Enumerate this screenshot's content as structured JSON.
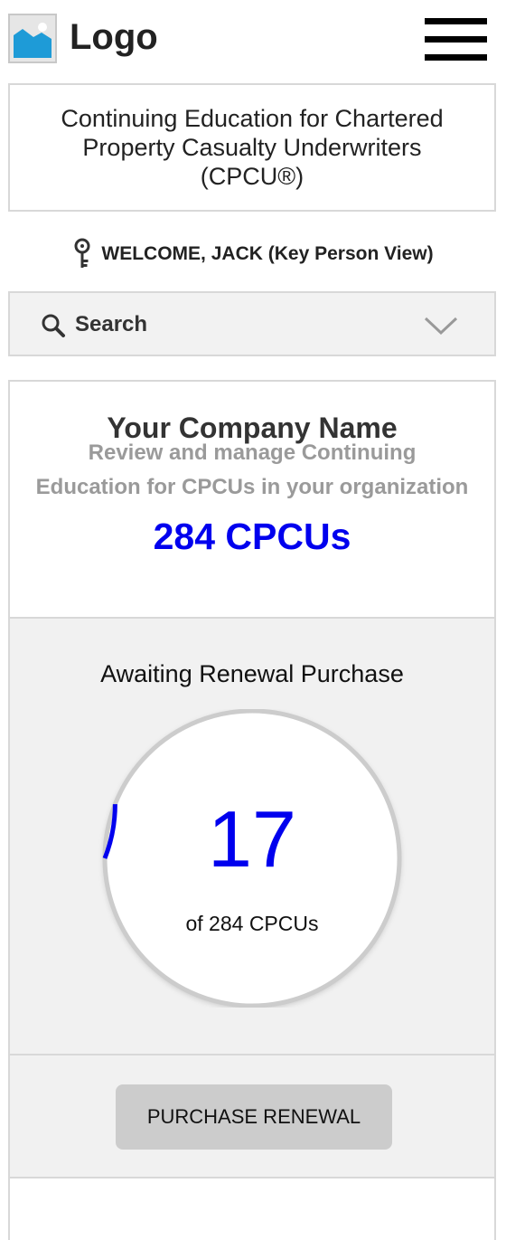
{
  "header": {
    "logo_text": "Logo",
    "logo_icon": "image-placeholder-icon",
    "menu_icon": "hamburger-menu-icon"
  },
  "program_title": "Continuing Education for Chartered Property Casualty Underwriters (CPCU®)",
  "welcome": {
    "icon": "key-icon",
    "text": "WELCOME, JACK (Key Person View)"
  },
  "search": {
    "label": "Search",
    "icon": "search-icon",
    "toggle_icon": "chevron-down-icon"
  },
  "company": {
    "name": "Your Company Name",
    "subtitle_line1": "Review and manage Continuing",
    "subtitle_line2": "Education for CPCUs in your organization",
    "count_label": "284 CPCUs"
  },
  "renewal": {
    "title": "Awaiting Renewal Purchase",
    "value": "17",
    "total_label": "of 284 CPCUs",
    "awaiting": 17,
    "total": 284,
    "button_label": "PURCHASE RENEWAL"
  },
  "colors": {
    "accent": "#0000ee",
    "track": "#cccccc",
    "button": "#cccccc",
    "panel": "#f1f1f1"
  }
}
